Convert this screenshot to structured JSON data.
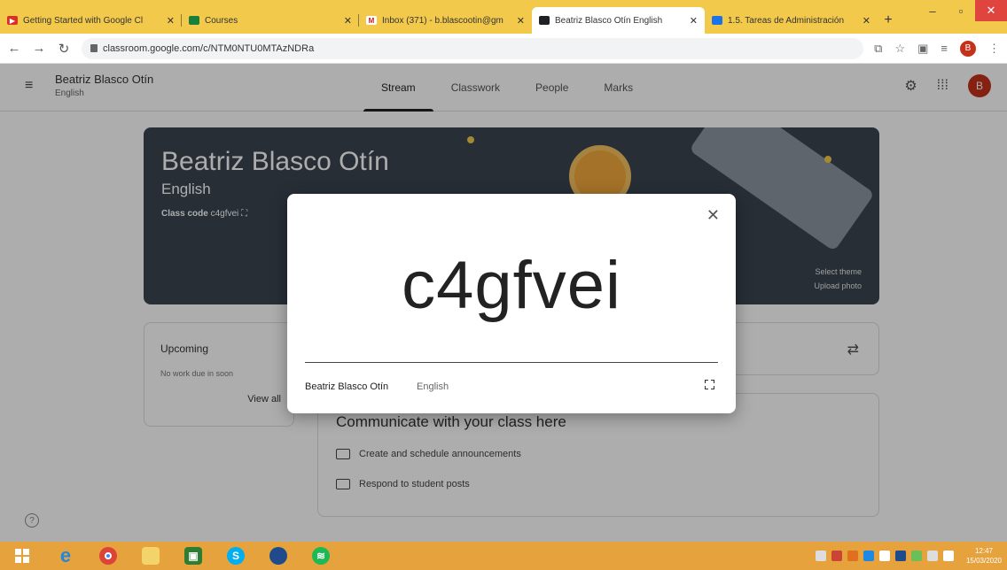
{
  "browser": {
    "tabs": [
      {
        "title": "Getting Started with Google Cl",
        "favicon_color": "#d93025",
        "active": false
      },
      {
        "title": "Courses",
        "favicon_color": "#188038",
        "active": false
      },
      {
        "title": "Inbox (371) - b.blascootin@gm",
        "favicon_color": "#c5221f",
        "active": false
      },
      {
        "title": "Beatriz Blasco Otín English",
        "favicon_color": "#202124",
        "active": true
      },
      {
        "title": "1.5. Tareas de Administración",
        "favicon_color": "#1a73e8",
        "active": false
      }
    ],
    "url": "classroom.google.com/c/NTM0NTU0MTAzNDRa",
    "profile_initial": "B"
  },
  "classroom": {
    "header": {
      "class_name": "Beatriz Blasco Otín",
      "section": "English",
      "tabs": [
        "Stream",
        "Classwork",
        "People",
        "Marks"
      ],
      "active_tab": "Stream",
      "avatar_initial": "B"
    },
    "banner": {
      "title": "Beatriz Blasco Otín",
      "subtitle": "English",
      "class_code_label": "Class code",
      "class_code": "c4gfvei",
      "select_theme": "Select theme",
      "upload_photo": "Upload photo"
    },
    "upcoming": {
      "title": "Upcoming",
      "empty_text": "No work due in soon",
      "view_all": "View all"
    },
    "communicate": {
      "title": "Communicate with your class here",
      "items": [
        "Create and schedule announcements",
        "Respond to student posts"
      ]
    }
  },
  "modal": {
    "class_code": "c4gfvei",
    "class_name": "Beatriz Blasco Otín",
    "section": "English"
  },
  "taskbar": {
    "time": "12:47",
    "date": "15/03/2020"
  }
}
